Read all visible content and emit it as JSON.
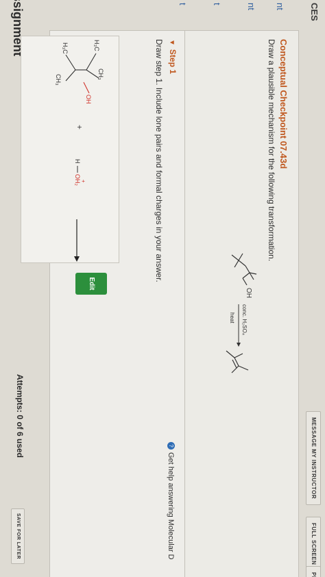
{
  "assignment_title": "ssignment",
  "nav": {
    "resources": "CES",
    "item1": "nt",
    "item2": "nt",
    "item3": "t",
    "item4": "t"
  },
  "topbar": {
    "message_instructor": "MESSAGE MY INSTRUCTOR",
    "full_screen": "FULL SCREEN",
    "printer": "PR"
  },
  "question": {
    "title": "Conceptual Checkpoint 07.43d",
    "description": "Draw a plausible mechanism for the following transformation.",
    "reaction": {
      "reactant_label": "OH",
      "reagent_above": "conc. H₂SO₄",
      "reagent_below": "heat"
    }
  },
  "help": {
    "text": "Get help answering Molecular D"
  },
  "step": {
    "title": "Step 1",
    "description": "Draw step 1. Include lone pairs and formal charges in your answer.",
    "structures": {
      "h3c_a": "H₃C",
      "ch3_a": "CH₃",
      "oh": "OH",
      "h3c_b": "H₃C",
      "ch3_b": "CH₃",
      "plus": "+",
      "h": "H",
      "oh2": "OH₂",
      "plus_charge": "+"
    }
  },
  "edit_button": "Edit",
  "attempts": "Attempts: 0 of 6 used",
  "save_for_later": "SAVE FOR LATER",
  "colors": {
    "accent": "#c0581f",
    "edit_green": "#2c8f3c",
    "link_blue": "#2f5e9e",
    "oxygen_red": "#d0342c"
  }
}
